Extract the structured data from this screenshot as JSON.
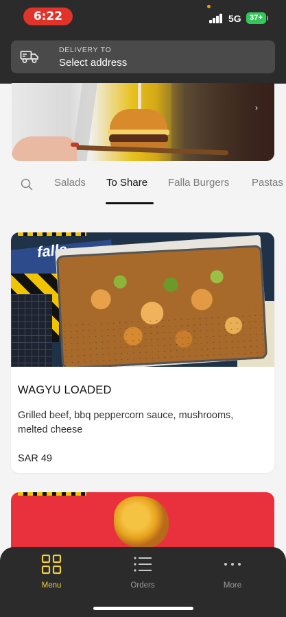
{
  "status_bar": {
    "time": "6:22",
    "network": "5G",
    "battery": "37+",
    "time_pill_color": "#e0342b",
    "battery_color": "#34c759"
  },
  "delivery": {
    "caption": "DELIVERY TO",
    "value": "Select address",
    "icon": "delivery-truck-icon"
  },
  "banner": {
    "icon": "chevron-right-icon"
  },
  "tabs": {
    "search_icon": "search-icon",
    "items": [
      {
        "label": "Salads",
        "active": false
      },
      {
        "label": "To Share",
        "active": true
      },
      {
        "label": "Falla Burgers",
        "active": false
      },
      {
        "label": "Pastas",
        "active": false
      }
    ]
  },
  "products": [
    {
      "name": "WAGYU LOADED",
      "description": "Grilled beef, bbq peppercorn sauce, mushrooms, melted cheese",
      "price": "SAR 49",
      "photo_label": "falla"
    }
  ],
  "bottom_nav": {
    "items": [
      {
        "label": "Menu",
        "icon": "grid-menu-icon",
        "active": true
      },
      {
        "label": "Orders",
        "icon": "list-icon",
        "active": false
      },
      {
        "label": "More",
        "icon": "more-dots-icon",
        "active": false
      }
    ],
    "active_color": "#f2d13b"
  }
}
